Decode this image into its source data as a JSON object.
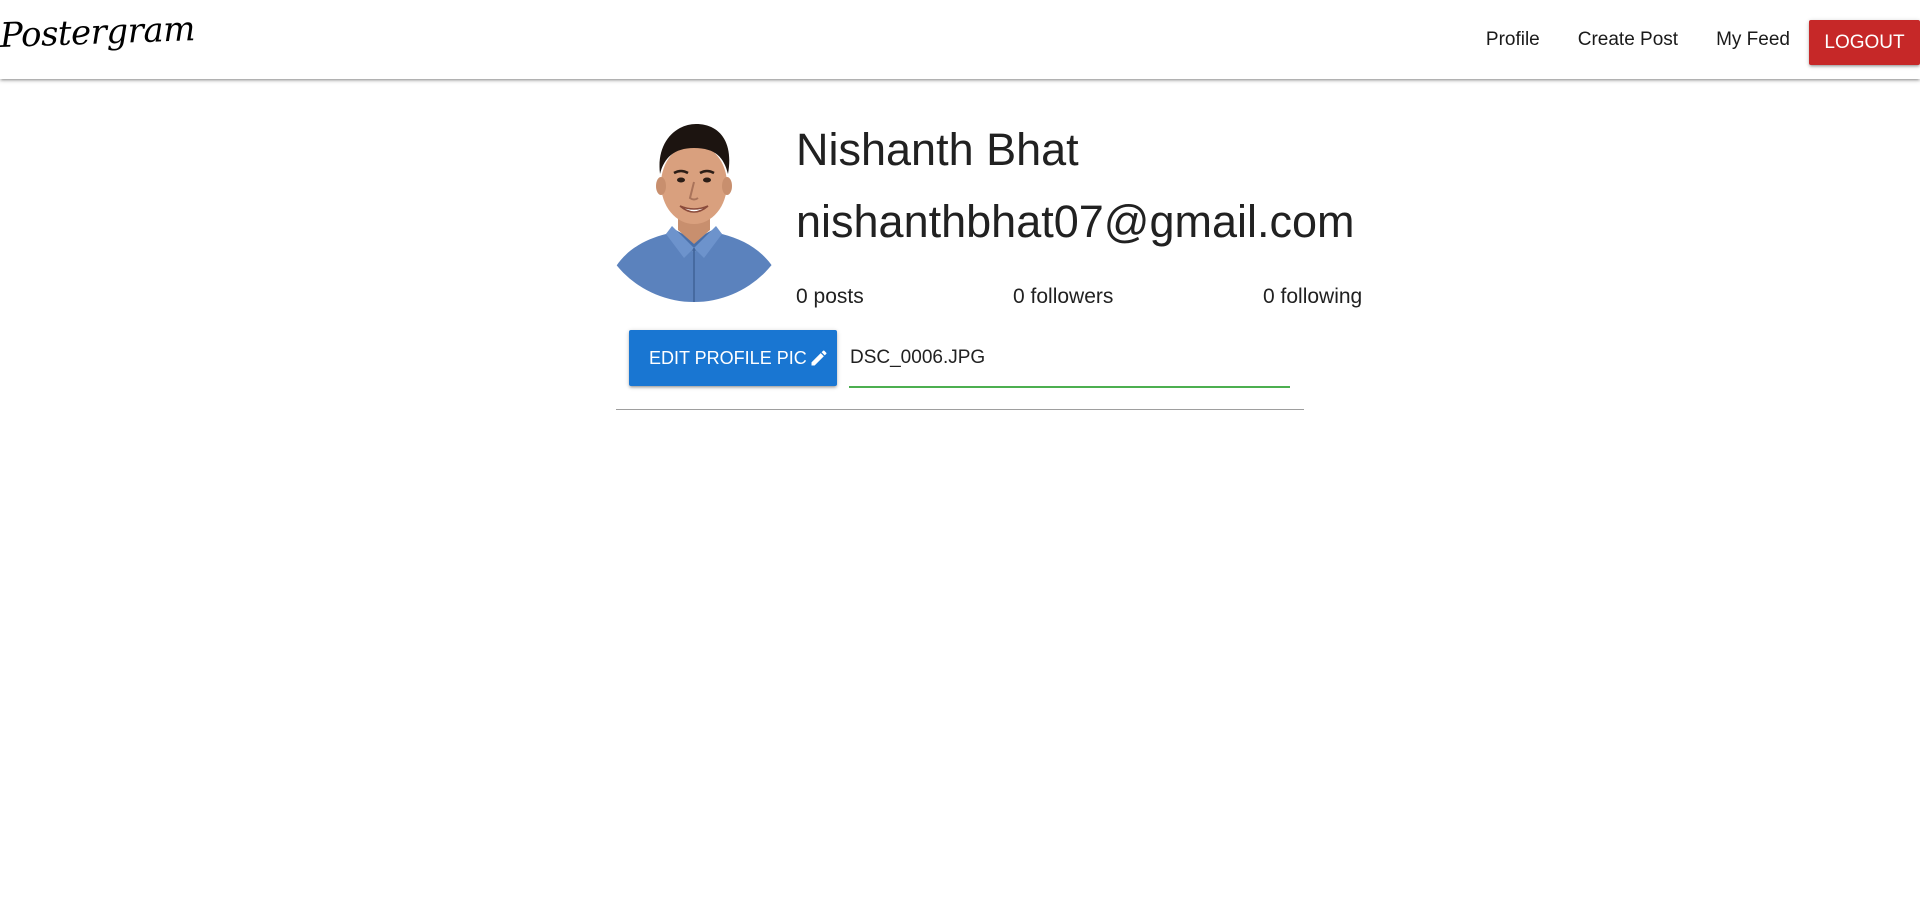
{
  "navbar": {
    "brand": "Postergram",
    "links": [
      {
        "label": "Profile"
      },
      {
        "label": "Create Post"
      },
      {
        "label": "My Feed"
      }
    ],
    "logout_label": "LOGOUT",
    "logout_color": "#c62828"
  },
  "profile": {
    "name": "Nishanth Bhat",
    "email": "nishanthbhat07@gmail.com",
    "stats": {
      "posts": "0 posts",
      "followers": "0 followers",
      "following": "0 following"
    },
    "edit_button_label": "EDIT PROFILE PIC",
    "edit_button_color": "#1976d2",
    "file_value": "DSC_0006.JPG",
    "file_underline_color": "#4caf50"
  },
  "icons": {
    "edit": "pencil-icon"
  }
}
